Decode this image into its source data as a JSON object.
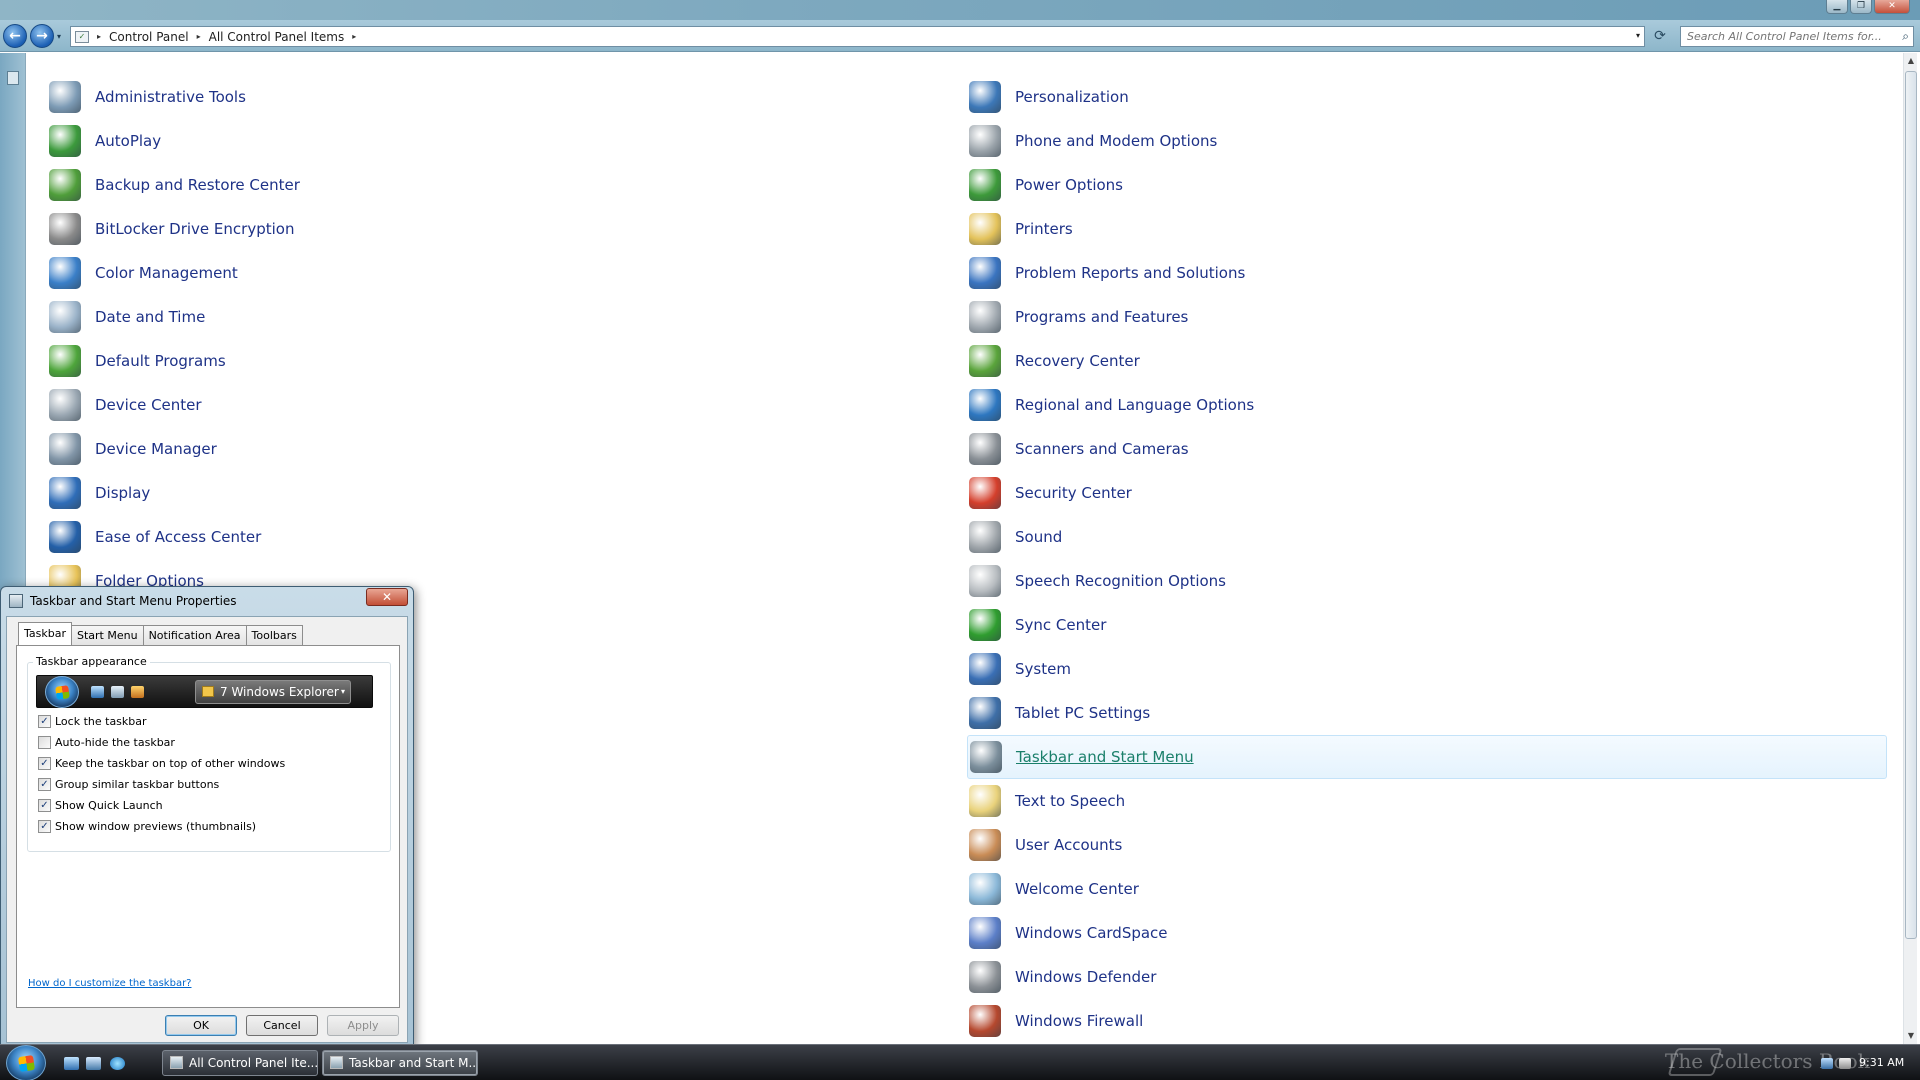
{
  "window": {
    "caption_minimize": "▁",
    "caption_maximize": "❐",
    "caption_close": "✕"
  },
  "navigation": {
    "back_glyph": "←",
    "forward_glyph": "→",
    "history_glyph": "▾",
    "breadcrumbs": [
      "Control Panel",
      "All Control Panel Items"
    ],
    "crumb_separator": "▸",
    "address_dropdown_glyph": "▾",
    "refresh_glyph": "⟳",
    "search_placeholder": "Search All Control Panel Items for...",
    "search_glyph": "⌕"
  },
  "control_panel": {
    "left_items": [
      {
        "label": "Administrative Tools",
        "icon": "administrative-tools-icon",
        "color": "#7d9bb5"
      },
      {
        "label": "AutoPlay",
        "icon": "autoplay-icon",
        "color": "#3c9a3c"
      },
      {
        "label": "Backup and Restore Center",
        "icon": "backup-restore-icon",
        "color": "#4f9e3a"
      },
      {
        "label": "BitLocker Drive Encryption",
        "icon": "bitlocker-icon",
        "color": "#8a8a8a"
      },
      {
        "label": "Color Management",
        "icon": "color-management-icon",
        "color": "#3a7fc8"
      },
      {
        "label": "Date and Time",
        "icon": "date-time-icon",
        "color": "#9bb3c9"
      },
      {
        "label": "Default Programs",
        "icon": "default-programs-icon",
        "color": "#4ea53b"
      },
      {
        "label": "Device Center",
        "icon": "device-center-icon",
        "color": "#9aa7b2"
      },
      {
        "label": "Device Manager",
        "icon": "device-manager-icon",
        "color": "#8296a8"
      },
      {
        "label": "Display",
        "icon": "display-icon",
        "color": "#2f6db8"
      },
      {
        "label": "Ease of Access Center",
        "icon": "ease-of-access-icon",
        "color": "#2460a8"
      },
      {
        "label": "Folder Options",
        "icon": "folder-options-icon",
        "color": "#e7c257"
      }
    ],
    "right_items": [
      {
        "label": "Personalization",
        "icon": "personalization-icon",
        "color": "#3d78b8"
      },
      {
        "label": "Phone and Modem Options",
        "icon": "phone-modem-icon",
        "color": "#9aa3aa"
      },
      {
        "label": "Power Options",
        "icon": "power-options-icon",
        "color": "#3d9a3a"
      },
      {
        "label": "Printers",
        "icon": "printers-icon",
        "color": "#e3c25a"
      },
      {
        "label": "Problem Reports and Solutions",
        "icon": "problem-reports-icon",
        "color": "#3a74c0"
      },
      {
        "label": "Programs and Features",
        "icon": "programs-features-icon",
        "color": "#a1a9b0"
      },
      {
        "label": "Recovery Center",
        "icon": "recovery-center-icon",
        "color": "#5aa43b"
      },
      {
        "label": "Regional and Language Options",
        "icon": "regional-language-icon",
        "color": "#2e77c0"
      },
      {
        "label": "Scanners and Cameras",
        "icon": "scanners-cameras-icon",
        "color": "#8a9096"
      },
      {
        "label": "Security Center",
        "icon": "security-center-icon",
        "color": "#d43f2c"
      },
      {
        "label": "Sound",
        "icon": "sound-icon",
        "color": "#a0a6ab"
      },
      {
        "label": "Speech Recognition Options",
        "icon": "speech-recognition-icon",
        "color": "#b7bcc0"
      },
      {
        "label": "Sync Center",
        "icon": "sync-center-icon",
        "color": "#2f9d2f"
      },
      {
        "label": "System",
        "icon": "system-icon",
        "color": "#3a6fb5"
      },
      {
        "label": "Tablet PC Settings",
        "icon": "tablet-pc-icon",
        "color": "#3f6fa8"
      },
      {
        "label": "Taskbar and Start Menu",
        "icon": "taskbar-start-menu-icon",
        "color": "#7c8f9c"
      },
      {
        "label": "Text to Speech",
        "icon": "text-to-speech-icon",
        "color": "#e9d27b"
      },
      {
        "label": "User Accounts",
        "icon": "user-accounts-icon",
        "color": "#c98c56"
      },
      {
        "label": "Welcome Center",
        "icon": "welcome-center-icon",
        "color": "#8bb8d8"
      },
      {
        "label": "Windows CardSpace",
        "icon": "cardspace-icon",
        "color": "#5c7fc8"
      },
      {
        "label": "Windows Defender",
        "icon": "windows-defender-icon",
        "color": "#8c9196"
      },
      {
        "label": "Windows Firewall",
        "icon": "windows-firewall-icon",
        "color": "#b5482e"
      }
    ],
    "hovered_label": "Taskbar and Start Menu"
  },
  "dialog": {
    "title": "Taskbar and Start Menu Properties",
    "close_glyph": "✕",
    "tabs": [
      "Taskbar",
      "Start Menu",
      "Notification Area",
      "Toolbars"
    ],
    "active_tab": "Taskbar",
    "group_title": "Taskbar appearance",
    "preview_task_label": "7 Windows Explorer",
    "preview_dropdown_glyph": "▾",
    "check_glyph": "✓",
    "options": [
      {
        "label": "Lock the taskbar",
        "checked": true
      },
      {
        "label": "Auto-hide the taskbar",
        "checked": false
      },
      {
        "label": "Keep the taskbar on top of other windows",
        "checked": true
      },
      {
        "label": "Group similar taskbar buttons",
        "checked": true
      },
      {
        "label": "Show Quick Launch",
        "checked": true
      },
      {
        "label": "Show window previews (thumbnails)",
        "checked": true
      }
    ],
    "help_link": "How do I customize the taskbar?",
    "ok_label": "OK",
    "cancel_label": "Cancel",
    "apply_label": "Apply"
  },
  "taskbar": {
    "tasks": [
      "All Control Panel Ite...",
      "Taskbar and Start M..."
    ],
    "watermark": "The Collectors Book",
    "clock": "9:31 AM"
  }
}
